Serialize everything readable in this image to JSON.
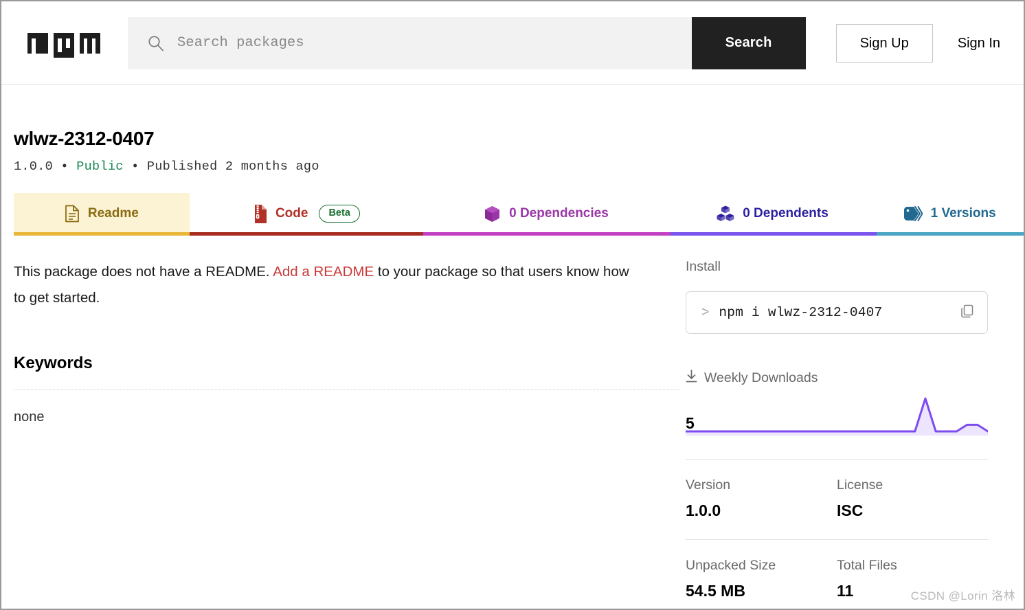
{
  "header": {
    "logo_alt": "npm",
    "search": {
      "placeholder": "Search packages",
      "value": "",
      "button_label": "Search"
    },
    "sign_up_label": "Sign Up",
    "sign_in_label": "Sign In"
  },
  "package": {
    "name": "wlwz-2312-0407",
    "version": "1.0.0",
    "visibility": "Public",
    "published": "Published 2 months ago",
    "separator": "•"
  },
  "tabs": [
    {
      "label": "Readme",
      "icon": "document-icon",
      "color": "#8a6d14",
      "underline": "#eab638",
      "active": true,
      "badge": null
    },
    {
      "label": "Code",
      "icon": "zip-file-icon",
      "color": "#b03127",
      "underline": "#a72b20",
      "active": false,
      "badge": "Beta"
    },
    {
      "label": "0 Dependencies",
      "icon": "package-icon",
      "color": "#9b36a8",
      "underline": "#c13fc4",
      "active": false,
      "badge": null
    },
    {
      "label": "0 Dependents",
      "icon": "blocks-icon",
      "color": "#2c1fa0",
      "underline": "#7b53ef",
      "active": false,
      "badge": null
    },
    {
      "label": "1 Versions",
      "icon": "tag-icon",
      "color": "#21698f",
      "underline": "#48a6c4",
      "active": false,
      "badge": null
    }
  ],
  "readme": {
    "text_before": "This package does not have a README. ",
    "link_text": "Add a README",
    "text_after": " to your package so that users know how to get started."
  },
  "keywords": {
    "heading": "Keywords",
    "value": "none"
  },
  "sidebar": {
    "install_label": "Install",
    "install_prompt": ">",
    "install_command": "npm i wlwz-2312-0407",
    "copy_icon": "copy-icon",
    "downloads_icon": "download-icon",
    "downloads_label": "Weekly Downloads",
    "downloads_count": "5",
    "version_label": "Version",
    "version_value": "1.0.0",
    "license_label": "License",
    "license_value": "ISC",
    "unpacked_size_label": "Unpacked Size",
    "unpacked_size_value": "54.5 MB",
    "total_files_label": "Total Files",
    "total_files_value": "11"
  },
  "chart_data": {
    "type": "area",
    "title": "Weekly Downloads",
    "xlabel": "",
    "ylabel": "Downloads",
    "ylim": [
      0,
      5
    ],
    "grid": false,
    "legend": "none",
    "line_color": "#7d4cf0",
    "fill_color": "#ece5fd",
    "x": [
      0,
      1,
      2,
      3,
      4,
      5,
      6,
      7,
      8,
      9,
      10,
      11,
      12,
      13,
      14,
      15,
      16,
      17,
      18,
      19,
      20,
      21,
      22,
      23,
      24,
      25,
      26,
      27,
      28,
      29
    ],
    "values": [
      0,
      0,
      0,
      0,
      0,
      0,
      0,
      0,
      0,
      0,
      0,
      0,
      0,
      0,
      0,
      0,
      0,
      0,
      0,
      0,
      0,
      0,
      0,
      5,
      0,
      0,
      0,
      1,
      1,
      0
    ],
    "note": "Flat at zero for most of the window with a single spike of 5 near the right edge, then small residual activity."
  },
  "watermark": {
    "text": "CSDN @Lorin 洛林"
  }
}
